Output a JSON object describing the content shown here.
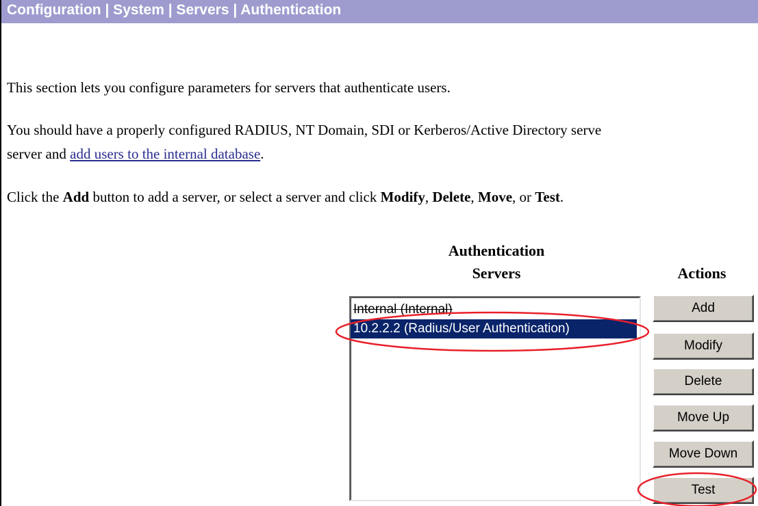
{
  "header": {
    "breadcrumb": "Configuration | System | Servers | Authentication"
  },
  "content": {
    "intro": "This section lets you configure parameters for servers that authenticate users.",
    "requirement_line1": "You should have a properly configured RADIUS, NT Domain, SDI or Kerberos/Active Directory serve",
    "requirement_line2_prefix": "server and ",
    "requirement_link": "add users to the internal database",
    "requirement_line2_suffix": ".",
    "instruction": {
      "p1": "Click the ",
      "add": "Add",
      "p2": " button to add a server, or select a server and click ",
      "modify": "Modify",
      "sep1": ", ",
      "delete": "Delete",
      "sep2": ", ",
      "move": "Move",
      "p3": ", or ",
      "test": "Test",
      "p4": "."
    }
  },
  "servers": {
    "heading_line1": "Authentication",
    "heading_line2": "Servers",
    "items": [
      {
        "label": "Internal (Internal)",
        "selected": false
      },
      {
        "label": "10.2.2.2 (Radius/User Authentication)",
        "selected": true
      }
    ]
  },
  "actions": {
    "heading": "Actions",
    "add": "Add",
    "modify": "Modify",
    "delete": "Delete",
    "move_up": "Move Up",
    "move_down": "Move Down",
    "test": "Test"
  },
  "colors": {
    "header_bg": "#9e9cce",
    "selection_bg": "#0a246a",
    "annotation": "#e8202a",
    "link": "#2a2e8f"
  }
}
